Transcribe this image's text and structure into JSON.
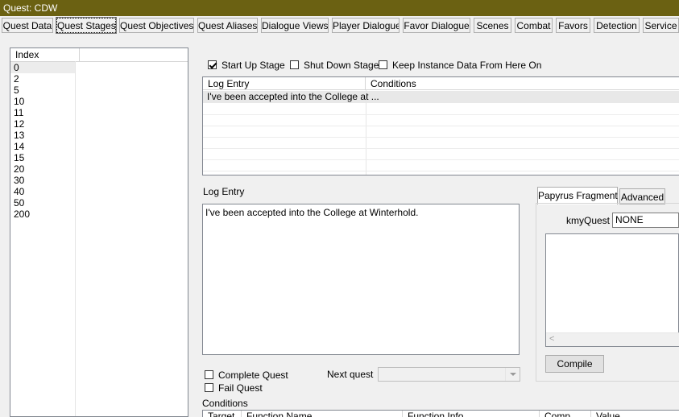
{
  "window": {
    "title": "Quest: CDW"
  },
  "tabs": [
    {
      "label": "Quest Data",
      "selected": false
    },
    {
      "label": "Quest Stages",
      "selected": true
    },
    {
      "label": "Quest Objectives",
      "selected": false
    },
    {
      "label": "Quest Aliases",
      "selected": false
    },
    {
      "label": "Dialogue Views",
      "selected": false
    },
    {
      "label": "Player Dialogue",
      "selected": false
    },
    {
      "label": "Favor Dialogue",
      "selected": false
    },
    {
      "label": "Scenes",
      "selected": false
    },
    {
      "label": "Combat",
      "selected": false
    },
    {
      "label": "Favors",
      "selected": false
    },
    {
      "label": "Detection",
      "selected": false
    },
    {
      "label": "Service",
      "selected": false
    }
  ],
  "stages": {
    "header": "Index",
    "items": [
      "0",
      "2",
      "5",
      "10",
      "11",
      "12",
      "13",
      "14",
      "15",
      "20",
      "30",
      "40",
      "50",
      "200"
    ],
    "selected_index": 0
  },
  "options": {
    "start_up_stage": {
      "label": "Start Up Stage",
      "checked": true
    },
    "shut_down_stage": {
      "label": "Shut Down Stage",
      "checked": false
    },
    "keep_instance_data": {
      "label": "Keep Instance Data From Here On",
      "checked": false
    }
  },
  "log_table": {
    "columns": [
      "Log Entry",
      "Conditions"
    ],
    "rows": [
      {
        "log_entry": "I've been accepted into the College at ...",
        "conditions": ""
      }
    ]
  },
  "log_entry": {
    "label": "Log Entry",
    "text": "I've been accepted into the College at Winterhold."
  },
  "flags": {
    "complete_quest": {
      "label": "Complete Quest",
      "checked": false
    },
    "fail_quest": {
      "label": "Fail Quest",
      "checked": false
    }
  },
  "next_quest": {
    "label": "Next quest",
    "value": ""
  },
  "papyrus": {
    "tabs": [
      "Papyrus Fragment",
      "Advanced"
    ],
    "active_tab": "Papyrus Fragment",
    "property_label": "kmyQuest",
    "property_value": "NONE",
    "compile_label": "Compile"
  },
  "conditions": {
    "label": "Conditions",
    "columns": [
      "Target",
      "Function Name",
      "Function Info",
      "Comp",
      "Value"
    ]
  },
  "colors": {
    "titlebar": "#6b6112",
    "selection": "#e8e8e8"
  }
}
